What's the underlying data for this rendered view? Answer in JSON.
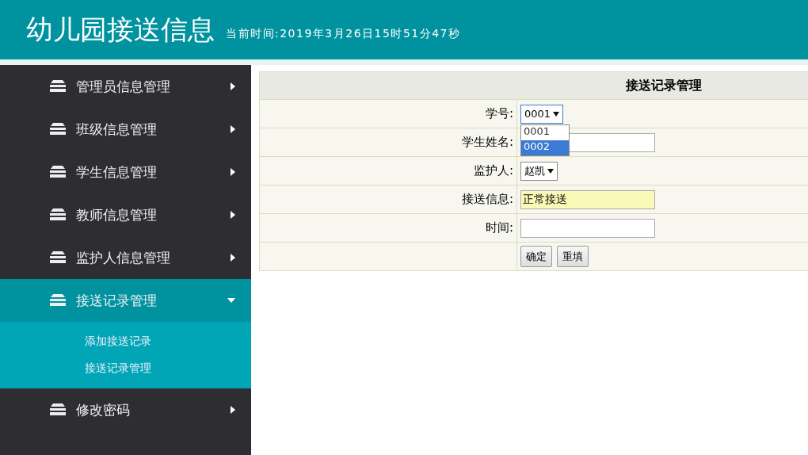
{
  "header": {
    "title": "幼儿园接送信息",
    "clock": "当前时间:2019年3月26日15时51分47秒"
  },
  "sidebar": {
    "items": [
      {
        "label": "管理员信息管理",
        "selected": false,
        "expanded": false
      },
      {
        "label": "班级信息管理",
        "selected": false,
        "expanded": false
      },
      {
        "label": "学生信息管理",
        "selected": false,
        "expanded": false
      },
      {
        "label": "教师信息管理",
        "selected": false,
        "expanded": false
      },
      {
        "label": "监护人信息管理",
        "selected": false,
        "expanded": false
      },
      {
        "label": "接送记录管理",
        "selected": true,
        "expanded": true,
        "children": [
          {
            "label": "添加接送记录"
          },
          {
            "label": "接送记录管理"
          }
        ]
      },
      {
        "label": "修改密码",
        "selected": false,
        "expanded": false
      }
    ]
  },
  "form": {
    "title": "接送记录管理",
    "fields": [
      {
        "kind": "select",
        "label": "学号:",
        "value": "0001",
        "open": true,
        "options": [
          {
            "label": "0001",
            "highlighted": false
          },
          {
            "label": "0002",
            "highlighted": true
          }
        ]
      },
      {
        "kind": "text",
        "label": "学生姓名:",
        "highlighted": false
      },
      {
        "kind": "select",
        "label": "监护人:",
        "value": "赵凯",
        "open": false
      },
      {
        "kind": "text",
        "label": "接送信息:",
        "value": "正常接送",
        "highlighted": true
      },
      {
        "kind": "text",
        "label": "时间:",
        "highlighted": false
      }
    ],
    "buttons": [
      "确定",
      "重填"
    ]
  }
}
